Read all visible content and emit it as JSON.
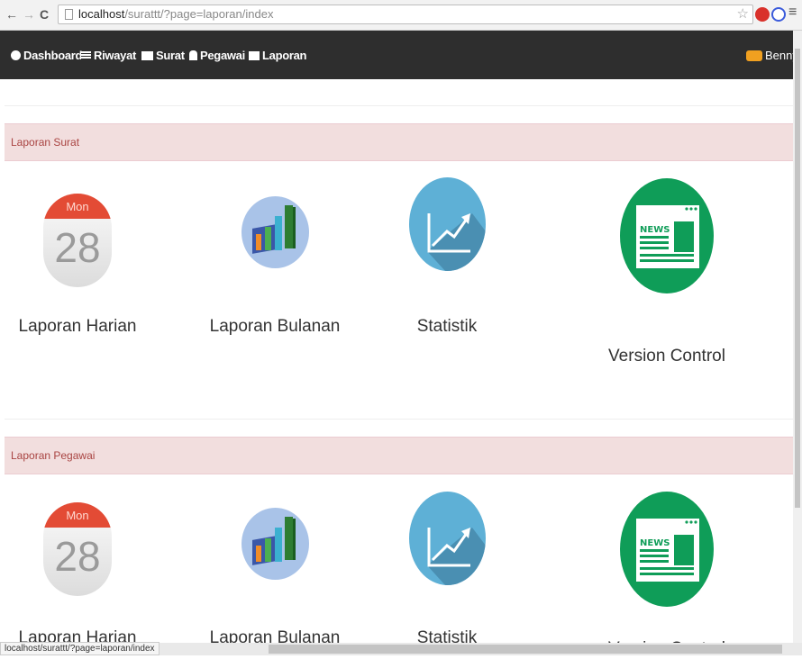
{
  "browser": {
    "url_host": "localhost",
    "url_path": "/surattt/?page=laporan/index",
    "status_url": "localhost/surattt/?page=laporan/index"
  },
  "navbar": {
    "items": [
      {
        "label": "Dashboard",
        "icon": "globe-icon"
      },
      {
        "label": "Riwayat",
        "icon": "list-icon"
      },
      {
        "label": "Surat",
        "icon": "folder-icon"
      },
      {
        "label": "Pegawai",
        "icon": "user-icon"
      },
      {
        "label": "Laporan",
        "icon": "briefcase-icon"
      }
    ],
    "user": "Benny"
  },
  "sections": [
    {
      "title": "Laporan Surat",
      "tiles": [
        {
          "label": "Laporan Harian",
          "icon": "calendar-icon",
          "cal_day_name": "Mon",
          "cal_day": "28"
        },
        {
          "label": "Laporan Bulanan",
          "icon": "bar-chart-icon"
        },
        {
          "label": "Statistik",
          "icon": "trend-chart-icon"
        },
        {
          "label": "Version Control",
          "icon": "news-icon",
          "badge": "NEWS"
        }
      ]
    },
    {
      "title": "Laporan Pegawai",
      "tiles": [
        {
          "label": "Laporan Harian",
          "icon": "calendar-icon",
          "cal_day_name": "Mon",
          "cal_day": "28"
        },
        {
          "label": "Laporan Bulanan",
          "icon": "bar-chart-icon"
        },
        {
          "label": "Statistik",
          "icon": "trend-chart-icon"
        },
        {
          "label": "Version Control",
          "icon": "news-icon",
          "badge": "NEWS"
        }
      ]
    }
  ],
  "colors": {
    "navbar_bg": "#2e2e2e",
    "panel_heading_bg": "#f2dede",
    "panel_heading_text": "#a94442",
    "calendar_red": "#e34b35",
    "stat_blue": "#5eb0d6",
    "news_green": "#0f9d58"
  }
}
